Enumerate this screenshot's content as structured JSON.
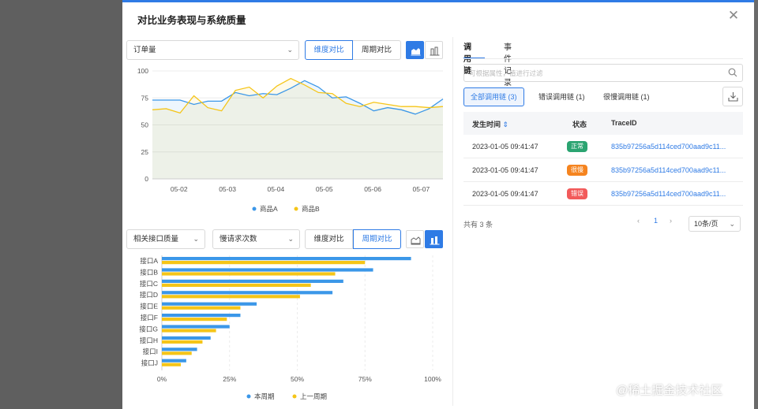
{
  "modal": {
    "title": "对比业务表现与系统质量",
    "close_icon": "close-icon"
  },
  "top_panel": {
    "metric_select": "订单量",
    "compare_buttons": [
      {
        "label": "维度对比",
        "active": true
      },
      {
        "label": "周期对比",
        "active": false
      }
    ],
    "view_icons": [
      "area-chart-icon",
      "bar-chart-icon"
    ]
  },
  "bottom_panel": {
    "select_1": "相关接口质量",
    "select_2": "慢请求次数",
    "compare_buttons": [
      {
        "label": "维度对比",
        "active": false
      },
      {
        "label": "周期对比",
        "active": true
      }
    ],
    "view_icons": [
      "area-chart-icon",
      "bar-chart-icon"
    ]
  },
  "chart_data": [
    {
      "type": "area",
      "categories": [
        "05-02",
        "05-03",
        "05-04",
        "05-05",
        "05-06",
        "05-07"
      ],
      "ylim": [
        0,
        100
      ],
      "yticks": [
        0,
        25,
        50,
        75,
        100
      ],
      "grid": true,
      "legend": "bottom",
      "series": [
        {
          "name": "商品A",
          "color": "#3b97e8",
          "values": [
            73,
            73,
            73,
            69,
            72,
            72,
            80,
            77,
            79,
            78,
            84,
            91,
            85,
            75,
            76,
            70,
            63,
            66,
            64,
            60,
            65,
            74
          ]
        },
        {
          "name": "商品B",
          "color": "#f5c518",
          "values": [
            64,
            65,
            61,
            77,
            66,
            63,
            82,
            85,
            75,
            86,
            93,
            87,
            80,
            79,
            70,
            67,
            71,
            69,
            67,
            67,
            66,
            67
          ]
        }
      ]
    },
    {
      "type": "bar",
      "orientation": "horizontal",
      "categories": [
        "接口A",
        "接口B",
        "接口C",
        "接口D",
        "接口E",
        "接口F",
        "接口G",
        "接口H",
        "接口I",
        "接口J"
      ],
      "xticks": [
        "0%",
        "25%",
        "50%",
        "75%",
        "100%"
      ],
      "xlim": [
        0,
        100
      ],
      "legend": "bottom",
      "series": [
        {
          "name": "本周期",
          "color": "#3b97e8",
          "values": [
            92,
            78,
            67,
            63,
            35,
            29,
            25,
            18,
            13,
            9
          ]
        },
        {
          "name": "上一周期",
          "color": "#f5c518",
          "values": [
            75,
            64,
            55,
            51,
            29,
            24,
            20,
            15,
            11,
            7
          ]
        }
      ]
    }
  ],
  "right_panel": {
    "tabs": [
      "调用链",
      "事件记录"
    ],
    "search_placeholder": "可根据属性，值进行过滤",
    "filters": [
      "全部调用链 (3)",
      "错误调用链 (1)",
      "很慢调用链 (1)"
    ],
    "table": {
      "headers": [
        "发生时间",
        "状态",
        "TraceID"
      ],
      "rows": [
        {
          "time": "2023-01-05 09:41:47",
          "status": "正常",
          "status_color": "#2ba471",
          "trace": "835b97256a5d114ced700aad9c11..."
        },
        {
          "time": "2023-01-05 09:41:47",
          "status": "很慢",
          "status_color": "#f5841f",
          "trace": "835b97256a5d114ced700aad9c11..."
        },
        {
          "time": "2023-01-05 09:41:47",
          "status": "错误",
          "status_color": "#f25a5a",
          "trace": "835b97256a5d114ced700aad9c11..."
        }
      ]
    },
    "pagination": {
      "total_label": "共有 3 条",
      "prev": "‹",
      "page": "1",
      "next": "›",
      "page_size": "10条/页"
    }
  },
  "watermark": "@稀土掘金技术社区",
  "colors": {
    "accent": "#2f7be5"
  }
}
